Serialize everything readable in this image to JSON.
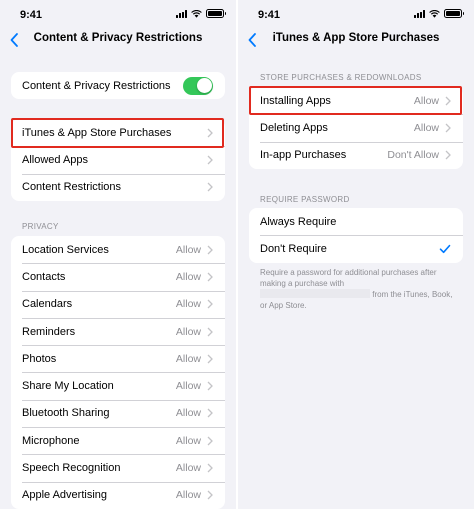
{
  "status_bar": {
    "time": "9:41"
  },
  "left": {
    "nav": {
      "title": "Content & Privacy Restrictions"
    },
    "toggle_group": {
      "label": "Content & Privacy Restrictions",
      "toggle_on": true,
      "accent": "#34c759"
    },
    "menu_items": [
      {
        "label": "iTunes & App Store Purchases"
      },
      {
        "label": "Allowed Apps"
      },
      {
        "label": "Content Restrictions"
      }
    ],
    "privacy_header": "PRIVACY",
    "privacy_items": [
      {
        "label": "Location Services",
        "value": "Allow"
      },
      {
        "label": "Contacts",
        "value": "Allow"
      },
      {
        "label": "Calendars",
        "value": "Allow"
      },
      {
        "label": "Reminders",
        "value": "Allow"
      },
      {
        "label": "Photos",
        "value": "Allow"
      },
      {
        "label": "Share My Location",
        "value": "Allow"
      },
      {
        "label": "Bluetooth Sharing",
        "value": "Allow"
      },
      {
        "label": "Microphone",
        "value": "Allow"
      },
      {
        "label": "Speech Recognition",
        "value": "Allow"
      },
      {
        "label": "Apple Advertising",
        "value": "Allow"
      }
    ]
  },
  "right": {
    "nav": {
      "title": "iTunes & App Store Purchases"
    },
    "store_header": "STORE PURCHASES & REDOWNLOADS",
    "store_items": [
      {
        "label": "Installing Apps",
        "value": "Allow"
      },
      {
        "label": "Deleting Apps",
        "value": "Allow"
      },
      {
        "label": "In-app Purchases",
        "value": "Don't Allow"
      }
    ],
    "password_header": "REQUIRE PASSWORD",
    "password_items": [
      {
        "label": "Always Require",
        "checked": false
      },
      {
        "label": "Don't Require",
        "checked": true
      }
    ],
    "footer_part1": "Require a password for additional purchases after making a purchase with",
    "footer_part2": "from the iTunes, Book, or App Store."
  },
  "colors": {
    "highlight": "#e12a1f",
    "link_blue": "#007aff",
    "background": "#f2f2f7"
  }
}
